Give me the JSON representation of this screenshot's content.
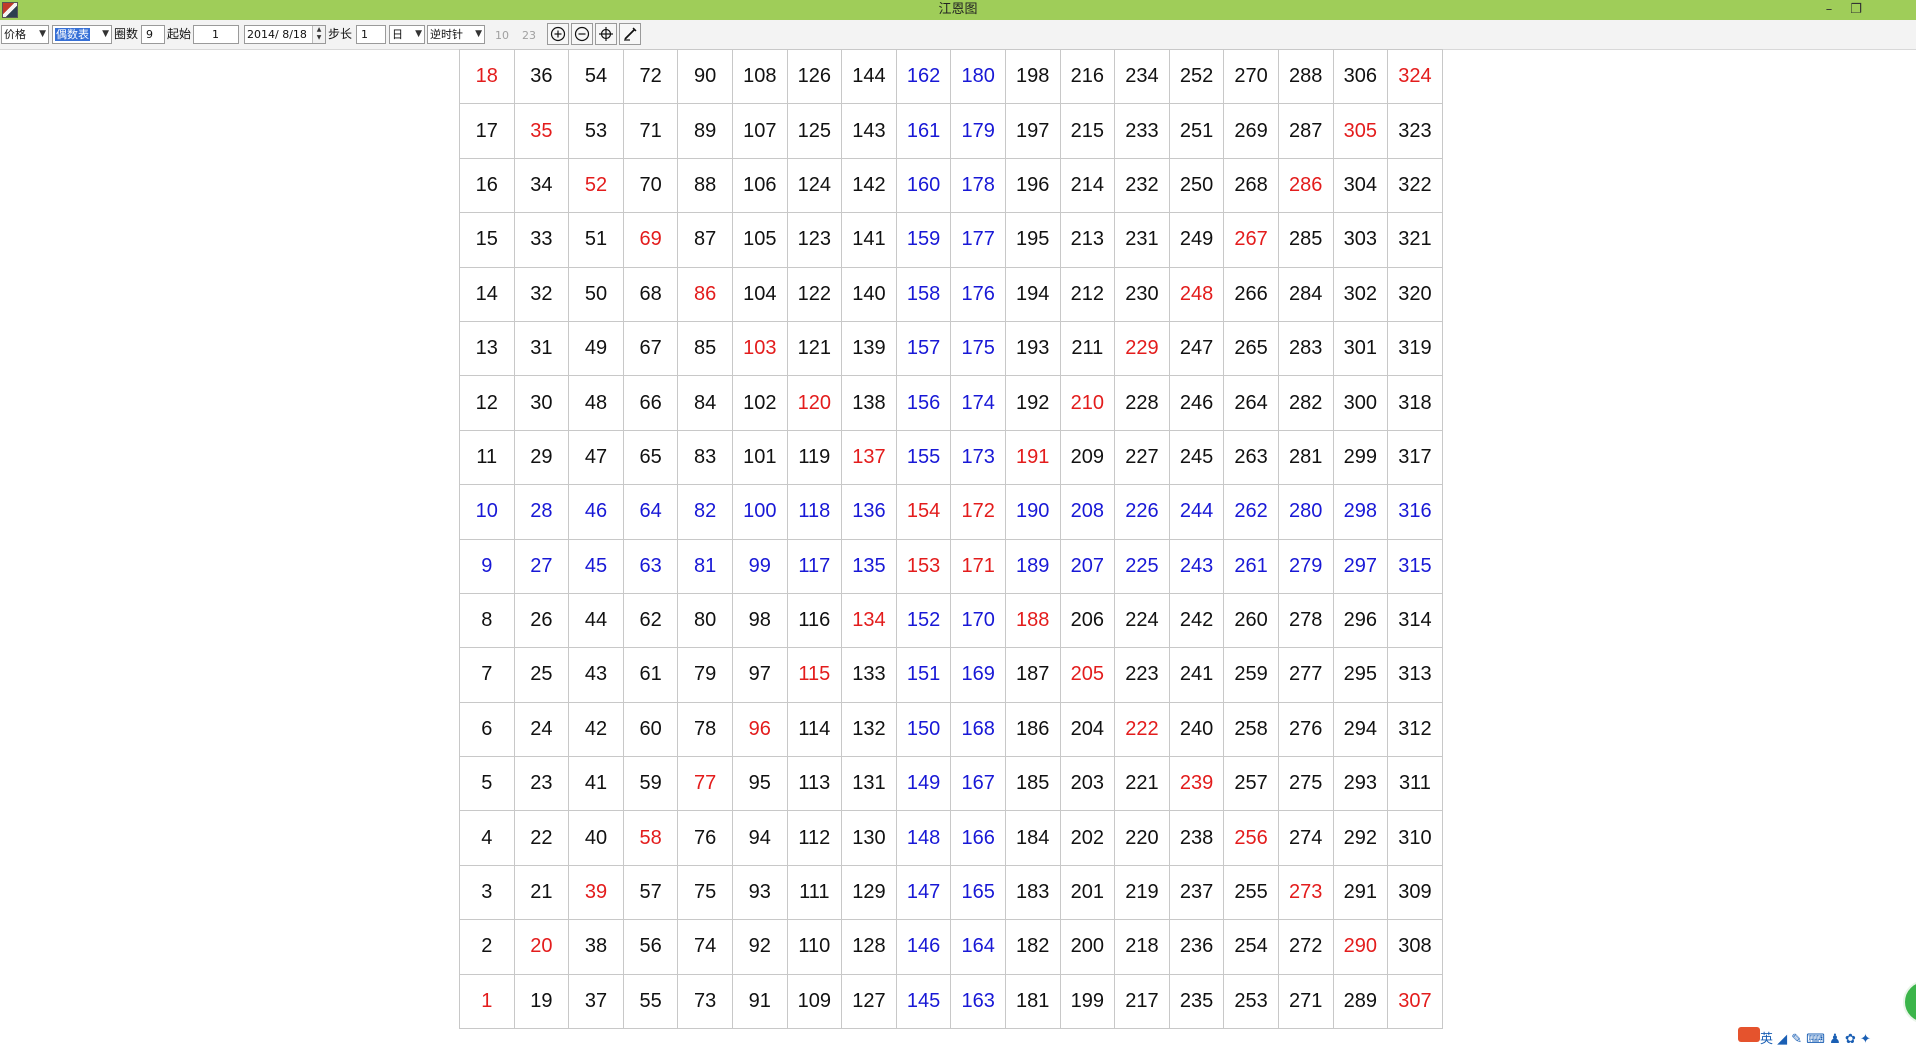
{
  "window": {
    "title": "江恩图",
    "minimize_glyph": "–",
    "restore_glyph": "❐"
  },
  "toolbar": {
    "price_select": "价格",
    "table_select": "偶数表",
    "circles_label": "圈数",
    "circles_value": "9",
    "start_label": "起始",
    "start_value": "1",
    "date_value": "2014/ 8/18",
    "step_label": "步长",
    "step_value": "1",
    "unit_select": "日",
    "direction_select": "逆时针",
    "val_a": "10",
    "val_b": "23",
    "zoom_in_icon": "zoom-in-icon",
    "zoom_out_icon": "zoom-out-icon",
    "center_icon": "crosshair-icon",
    "draw_icon": "pen-icon"
  },
  "grid": {
    "colors": {
      "black": "#111111",
      "red": "#e31c1c",
      "blue": "#1818d6"
    },
    "rows": [
      [
        "18",
        "36",
        "54",
        "72",
        "90",
        "108",
        "126",
        "144",
        "162",
        "180",
        "198",
        "216",
        "234",
        "252",
        "270",
        "288",
        "306",
        "324"
      ],
      [
        "17",
        "35",
        "53",
        "71",
        "89",
        "107",
        "125",
        "143",
        "161",
        "179",
        "197",
        "215",
        "233",
        "251",
        "269",
        "287",
        "305",
        "323"
      ],
      [
        "16",
        "34",
        "52",
        "70",
        "88",
        "106",
        "124",
        "142",
        "160",
        "178",
        "196",
        "214",
        "232",
        "250",
        "268",
        "286",
        "304",
        "322"
      ],
      [
        "15",
        "33",
        "51",
        "69",
        "87",
        "105",
        "123",
        "141",
        "159",
        "177",
        "195",
        "213",
        "231",
        "249",
        "267",
        "285",
        "303",
        "321"
      ],
      [
        "14",
        "32",
        "50",
        "68",
        "86",
        "104",
        "122",
        "140",
        "158",
        "176",
        "194",
        "212",
        "230",
        "248",
        "266",
        "284",
        "302",
        "320"
      ],
      [
        "13",
        "31",
        "49",
        "67",
        "85",
        "103",
        "121",
        "139",
        "157",
        "175",
        "193",
        "211",
        "229",
        "247",
        "265",
        "283",
        "301",
        "319"
      ],
      [
        "12",
        "30",
        "48",
        "66",
        "84",
        "102",
        "120",
        "138",
        "156",
        "174",
        "192",
        "210",
        "228",
        "246",
        "264",
        "282",
        "300",
        "318"
      ],
      [
        "11",
        "29",
        "47",
        "65",
        "83",
        "101",
        "119",
        "137",
        "155",
        "173",
        "191",
        "209",
        "227",
        "245",
        "263",
        "281",
        "299",
        "317"
      ],
      [
        "10",
        "28",
        "46",
        "64",
        "82",
        "100",
        "118",
        "136",
        "154",
        "172",
        "190",
        "208",
        "226",
        "244",
        "262",
        "280",
        "298",
        "316"
      ],
      [
        "9",
        "27",
        "45",
        "63",
        "81",
        "99",
        "117",
        "135",
        "153",
        "171",
        "189",
        "207",
        "225",
        "243",
        "261",
        "279",
        "297",
        "315"
      ],
      [
        "8",
        "26",
        "44",
        "62",
        "80",
        "98",
        "116",
        "134",
        "152",
        "170",
        "188",
        "206",
        "224",
        "242",
        "260",
        "278",
        "296",
        "314"
      ],
      [
        "7",
        "25",
        "43",
        "61",
        "79",
        "97",
        "115",
        "133",
        "151",
        "169",
        "187",
        "205",
        "223",
        "241",
        "259",
        "277",
        "295",
        "313"
      ],
      [
        "6",
        "24",
        "42",
        "60",
        "78",
        "96",
        "114",
        "132",
        "150",
        "168",
        "186",
        "204",
        "222",
        "240",
        "258",
        "276",
        "294",
        "312"
      ],
      [
        "5",
        "23",
        "41",
        "59",
        "77",
        "95",
        "113",
        "131",
        "149",
        "167",
        "185",
        "203",
        "221",
        "239",
        "257",
        "275",
        "293",
        "311"
      ],
      [
        "4",
        "22",
        "40",
        "58",
        "76",
        "94",
        "112",
        "130",
        "148",
        "166",
        "184",
        "202",
        "220",
        "238",
        "256",
        "274",
        "292",
        "310"
      ],
      [
        "3",
        "21",
        "39",
        "57",
        "75",
        "93",
        "111",
        "129",
        "147",
        "165",
        "183",
        "201",
        "219",
        "237",
        "255",
        "273",
        "291",
        "309"
      ],
      [
        "2",
        "20",
        "38",
        "56",
        "74",
        "92",
        "110",
        "128",
        "146",
        "164",
        "182",
        "200",
        "218",
        "236",
        "254",
        "272",
        "290",
        "308"
      ],
      [
        "1",
        "19",
        "37",
        "55",
        "73",
        "91",
        "109",
        "127",
        "145",
        "163",
        "181",
        "199",
        "217",
        "235",
        "253",
        "271",
        "289",
        "307"
      ]
    ],
    "cell_colors": [
      "RKKKKKKKBBKKKKKKKR",
      "KRKKKKKKBBKKKKKKRK",
      "KKRKKKKKBBKKKKKRKK",
      "KKKRKKKKBBKKKKRKKK",
      "KKKKRKKKBBKKKRKKKK",
      "KKKKKRKKBBKKRKKKKK",
      "KKKKKKRKBBKRKKKKKK",
      "KKKKKKKRBBRKKKKKKK",
      "BBBBBBBBRRBBBBBBBB",
      "BBBBBBBBRRBBBBBBBB",
      "KKKKKKKRBBRKKKKKKK",
      "KKKKKKRKBBKRKKKKKK",
      "KKKKKRKKBBKKRKKKKK",
      "KKKKRKKKBBKKKRKKKK",
      "KKKRKKKKBBKKKKRKKK",
      "KKRKKKKKBBKKKKKRKK",
      "KRKKKKKKBBKKKKKKRK",
      "RKKKKKKKBBKKKKKKKR"
    ]
  },
  "tray": {
    "ime_text": "英 ◢ ✎ ⌨ ♟ ✿ ✦"
  }
}
